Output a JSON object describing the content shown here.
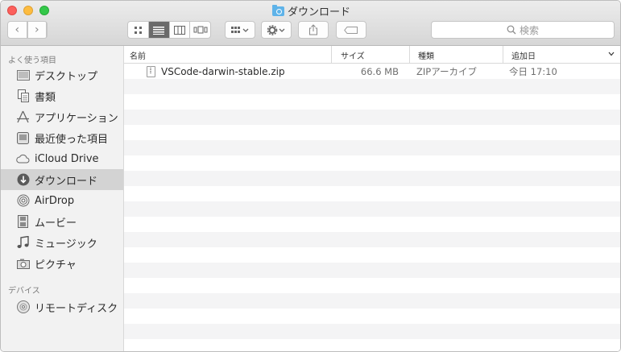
{
  "window": {
    "title": "ダウンロード"
  },
  "toolbar": {
    "back_icon": "chevron-left-icon",
    "forward_icon": "chevron-right-icon",
    "view_modes": [
      "icon-view-icon",
      "list-view-icon",
      "column-view-icon",
      "cover-flow-icon"
    ],
    "active_view": 1,
    "search_placeholder": "検索"
  },
  "sidebar": {
    "favorites_title": "よく使う項目",
    "favorites": [
      {
        "label": "デスクトップ",
        "icon": "desktop-icon"
      },
      {
        "label": "書類",
        "icon": "documents-icon"
      },
      {
        "label": "アプリケーション",
        "icon": "applications-icon"
      },
      {
        "label": "最近使った項目",
        "icon": "recents-icon"
      },
      {
        "label": "iCloud Drive",
        "icon": "cloud-icon"
      },
      {
        "label": "ダウンロード",
        "icon": "downloads-icon",
        "selected": true
      },
      {
        "label": "AirDrop",
        "icon": "airdrop-icon"
      },
      {
        "label": "ムービー",
        "icon": "movies-icon"
      },
      {
        "label": "ミュージック",
        "icon": "music-icon"
      },
      {
        "label": "ピクチャ",
        "icon": "pictures-icon"
      }
    ],
    "devices_title": "デバイス",
    "devices": [
      {
        "label": "リモートディスク",
        "icon": "disc-icon"
      }
    ]
  },
  "table": {
    "columns": [
      "名前",
      "サイズ",
      "種類",
      "追加日"
    ],
    "rows": [
      {
        "name": "VSCode-darwin-stable.zip",
        "size": "66.6 MB",
        "kind": "ZIPアーカイブ",
        "date_added": "今日 17:10"
      }
    ]
  }
}
